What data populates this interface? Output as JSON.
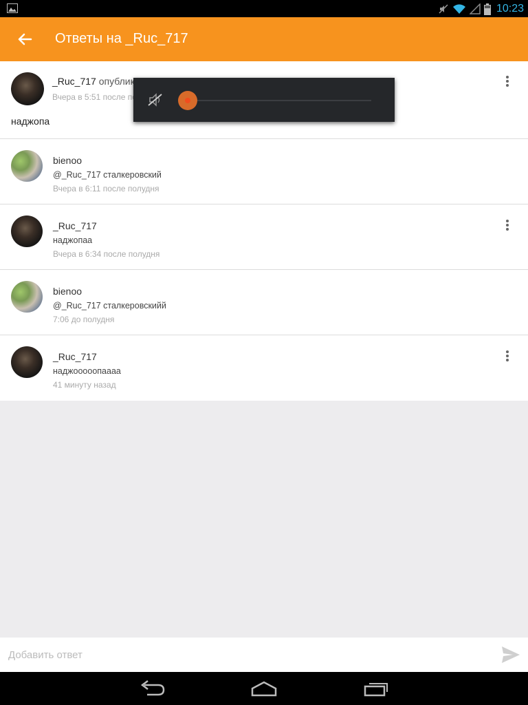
{
  "status_bar": {
    "time": "10:23",
    "icons": [
      "picture-icon",
      "mute-icon",
      "wifi-icon",
      "signal-icon",
      "battery-icon"
    ]
  },
  "app_bar": {
    "title": "Ответы на _Ruc_717",
    "background": "#f7931e"
  },
  "post": {
    "author": "_Ruc_717",
    "action": "опублик",
    "time": "Вчера в 5:51 после по",
    "text": "наджопа"
  },
  "replies": [
    {
      "author": "bienoo",
      "text": "@_Ruc_717 сталкеровский",
      "time": "Вчера в 6:11 после полудня",
      "has_menu": false,
      "avatar": "green"
    },
    {
      "author": "_Ruc_717",
      "text": "наджопаа",
      "time": "Вчера в 6:34 после полудня",
      "has_menu": true,
      "avatar": "dark"
    },
    {
      "author": "bienoo",
      "text": "@_Ruc_717 сталкеровскийй",
      "time": "7:06 до полудня",
      "has_menu": false,
      "avatar": "green"
    },
    {
      "author": "_Ruc_717",
      "text": "наджооооопаааа",
      "time": "41 минуту назад",
      "has_menu": true,
      "avatar": "dark"
    }
  ],
  "volume_panel": {
    "level": 0,
    "muted": true,
    "accent": "#d86b2a"
  },
  "reply_bar": {
    "placeholder": "Добавить ответ",
    "value": ""
  },
  "nav_bar": {
    "buttons": [
      "back-icon",
      "home-icon",
      "recent-apps-icon"
    ]
  }
}
